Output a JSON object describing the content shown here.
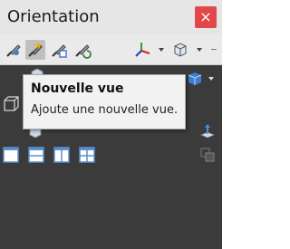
{
  "window": {
    "title": "Orientation",
    "close_label": "×"
  },
  "toolbar": {
    "icons": [
      "pin-view-icon",
      "new-view-icon",
      "update-view-icon",
      "reset-view-icon",
      "view-selector-triad-icon",
      "display-style-icon"
    ]
  },
  "tooltip": {
    "title": "Nouvelle vue",
    "description": "Ajoute une nouvelle vue."
  },
  "colors": {
    "panel_bg": "#3b3b3b",
    "close_red": "#e2474a",
    "toolbar_bg": "#eaeaea"
  }
}
